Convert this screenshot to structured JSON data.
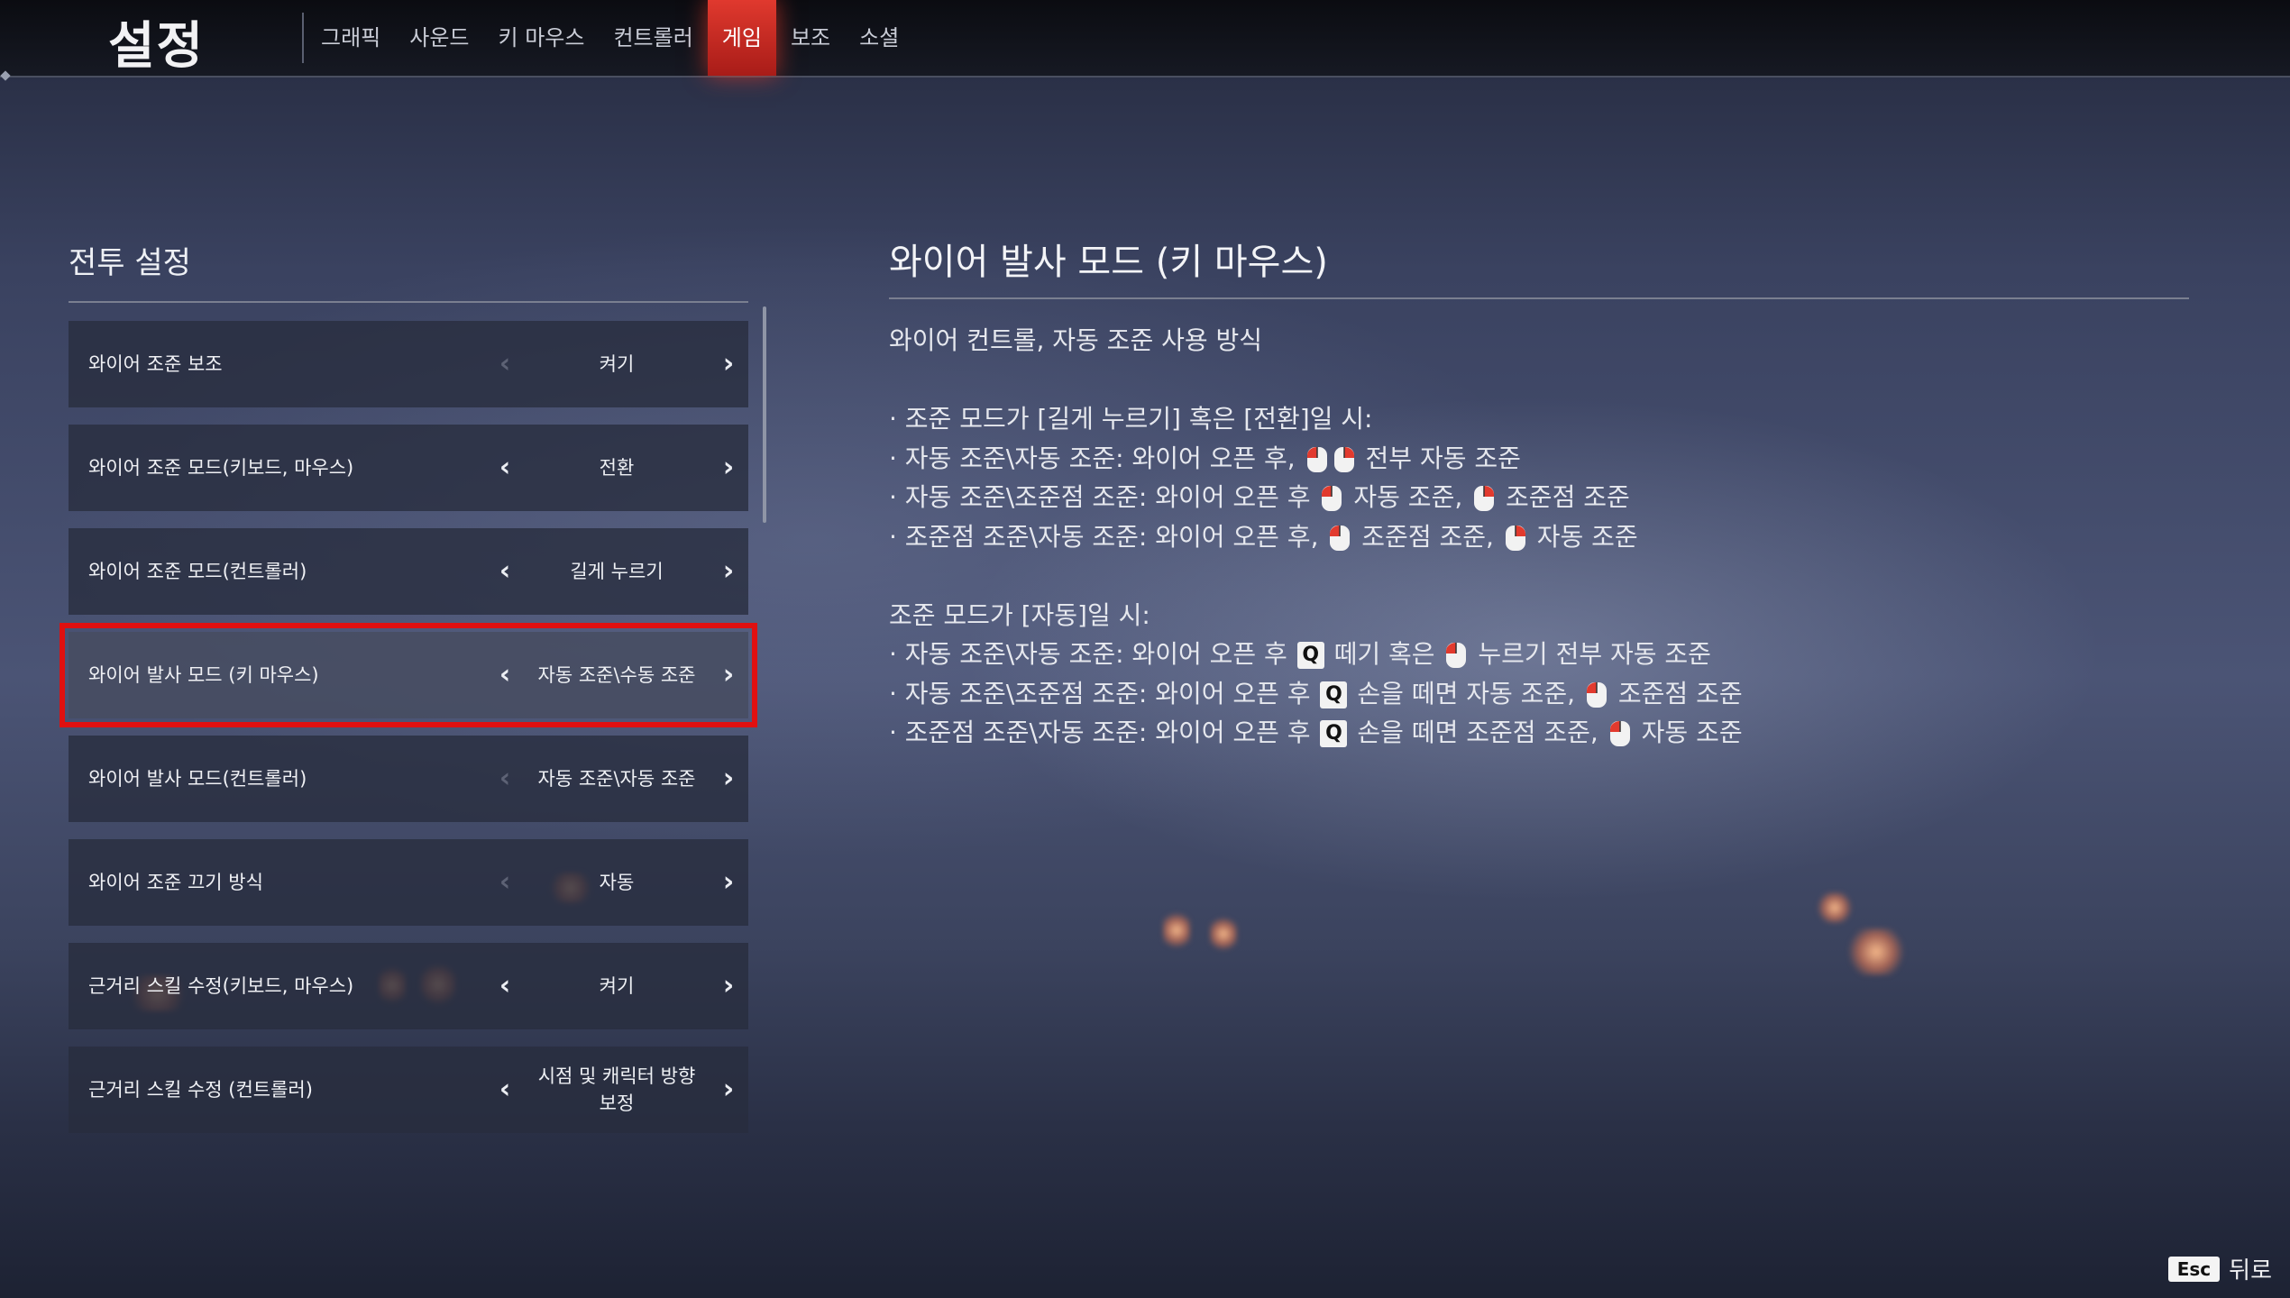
{
  "app": {
    "title": "설정"
  },
  "tabs": [
    {
      "label": "그래픽",
      "active": false
    },
    {
      "label": "사운드",
      "active": false
    },
    {
      "label": "키 마우스",
      "active": false
    },
    {
      "label": "컨트롤러",
      "active": false
    },
    {
      "label": "게임",
      "active": true
    },
    {
      "label": "보조",
      "active": false
    },
    {
      "label": "소셜",
      "active": false
    }
  ],
  "section": {
    "title": "전투 설정"
  },
  "settings": [
    {
      "label": "와이어 조준 보조",
      "value": "켜기",
      "left_enabled": false,
      "right_enabled": true,
      "selected": false
    },
    {
      "label": "와이어 조준 모드(키보드, 마우스)",
      "value": "전환",
      "left_enabled": true,
      "right_enabled": true,
      "selected": false
    },
    {
      "label": "와이어 조준 모드(컨트롤러)",
      "value": "길게 누르기",
      "left_enabled": true,
      "right_enabled": true,
      "selected": false
    },
    {
      "label": "와이어 발사 모드 (키 마우스)",
      "value": "자동 조준\\수동 조준",
      "left_enabled": true,
      "right_enabled": true,
      "selected": true
    },
    {
      "label": "와이어 발사 모드(컨트롤러)",
      "value": "자동 조준\\자동 조준",
      "left_enabled": false,
      "right_enabled": true,
      "selected": false
    },
    {
      "label": "와이어 조준 끄기 방식",
      "value": "자동",
      "left_enabled": false,
      "right_enabled": true,
      "selected": false
    },
    {
      "label": "근거리 스킬 수정(키보드, 마우스)",
      "value": "켜기",
      "left_enabled": true,
      "right_enabled": true,
      "selected": false
    },
    {
      "label": "근거리 스킬 수정 (컨트롤러)",
      "value": "시점 및 캐릭터 방향\n보정",
      "left_enabled": true,
      "right_enabled": true,
      "selected": false
    }
  ],
  "description": {
    "title": "와이어 발사 모드 (키 마우스)",
    "subtitle": "와이어 컨트롤, 자동 조준 사용 방식",
    "hold_header": "· 조준 모드가 [길게 누르기] 혹은 [전환]일 시:",
    "hold_lines": [
      {
        "prefix": "· 자동 조준\\자동 조준: 와이어 오픈 후,",
        "suffix": "전부 자동 조준"
      },
      {
        "prefix": "· 자동 조준\\조준점 조준: 와이어 오픈 후",
        "mid": "자동 조준,",
        "suffix": "조준점 조준"
      },
      {
        "prefix": "· 조준점 조준\\자동 조준: 와이어 오픈 후,",
        "mid": "조준점 조준,",
        "suffix": "자동 조준"
      }
    ],
    "auto_header": "조준 모드가 [자동]일 시:",
    "key_q": "Q",
    "auto_lines": [
      {
        "prefix": "· 자동 조준\\자동 조준: 와이어 오픈 후",
        "mid": "떼기 혹은",
        "suffix": "누르기 전부 자동 조준"
      },
      {
        "prefix": "· 자동 조준\\조준점 조준: 와이어 오픈 후",
        "mid": "손을 떼면 자동 조준,",
        "suffix": "조준점 조준"
      },
      {
        "prefix": "· 조준점 조준\\자동 조준: 와이어 오픈 후",
        "mid": "손을 떼면 조준점 조준,",
        "suffix": "자동 조준"
      }
    ]
  },
  "footer": {
    "esc_key": "Esc",
    "back_label": "뒤로"
  },
  "icons": {
    "mouse_left": "mouse-left-button-icon",
    "mouse_right": "mouse-right-button-icon"
  },
  "colors": {
    "accent": "#e0392e",
    "selection_outline": "#e01010"
  }
}
